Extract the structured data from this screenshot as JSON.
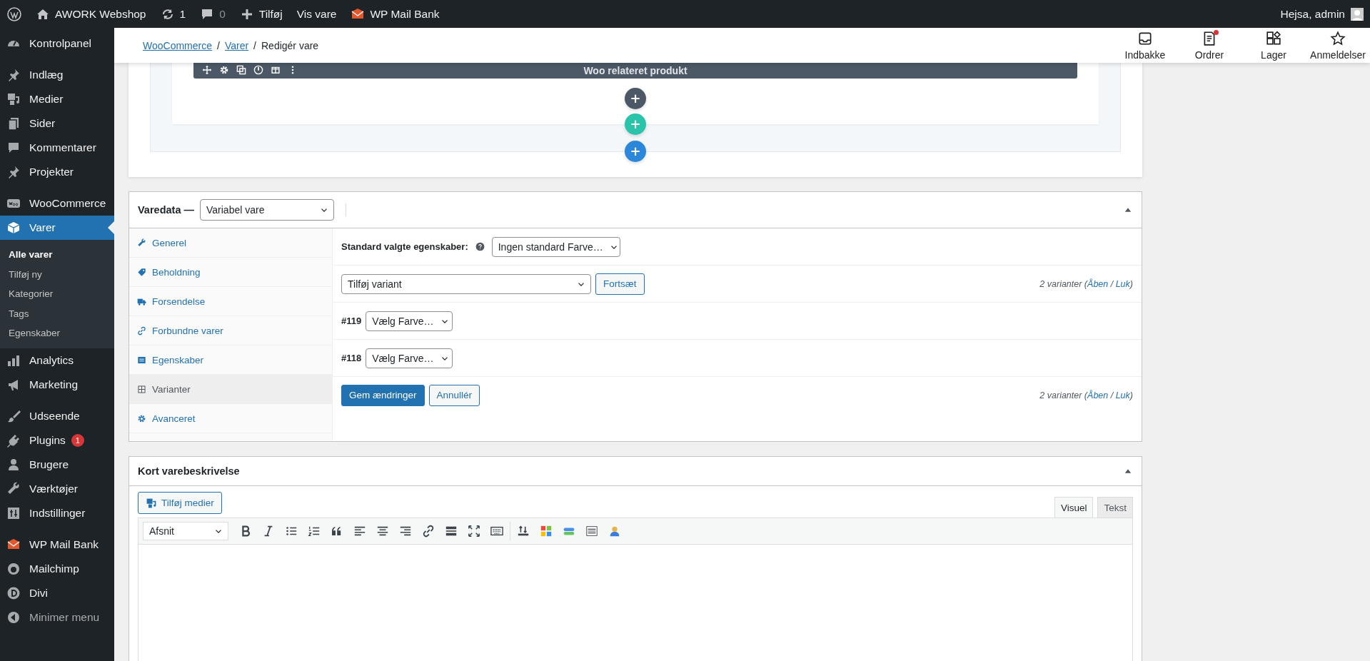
{
  "admin_bar": {
    "site": "AWORK Webshop",
    "updates": "1",
    "comments": "0",
    "new": "Tilføj",
    "view": "Vis vare",
    "plugin": "WP Mail Bank",
    "greeting": "Hejsa, admin"
  },
  "sidebar": {
    "groups": [
      [
        {
          "label": "Kontrolpanel",
          "current": false
        }
      ],
      [
        {
          "label": "Indlæg",
          "current": false
        },
        {
          "label": "Medier",
          "current": false
        },
        {
          "label": "Sider",
          "current": false
        },
        {
          "label": "Kommentarer",
          "current": false
        },
        {
          "label": "Projekter",
          "current": false
        }
      ],
      [
        {
          "label": "WooCommerce",
          "current": false
        },
        {
          "label": "Varer",
          "current": true,
          "children": [
            {
              "label": "Alle varer",
              "selected": true
            },
            {
              "label": "Tilføj ny",
              "selected": false
            },
            {
              "label": "Kategorier",
              "selected": false
            },
            {
              "label": "Tags",
              "selected": false
            },
            {
              "label": "Egenskaber",
              "selected": false
            }
          ]
        },
        {
          "label": "Analytics",
          "current": false
        },
        {
          "label": "Marketing",
          "current": false
        }
      ],
      [
        {
          "label": "Udseende",
          "current": false
        },
        {
          "label": "Plugins",
          "current": false,
          "badge": "1"
        },
        {
          "label": "Brugere",
          "current": false
        },
        {
          "label": "Værktøjer",
          "current": false
        },
        {
          "label": "Indstillinger",
          "current": false
        }
      ],
      [
        {
          "label": "WP Mail Bank",
          "current": false
        },
        {
          "label": "Mailchimp",
          "current": false
        },
        {
          "label": "Divi",
          "current": false
        },
        {
          "label": "Minimer menu",
          "current": false
        }
      ]
    ]
  },
  "header": {
    "breadcrumbs": [
      {
        "kind": "link",
        "text": "WooCommerce"
      },
      {
        "kind": "separator",
        "text": "/"
      },
      {
        "kind": "link",
        "text": "Varer"
      },
      {
        "kind": "separator",
        "text": "/"
      },
      {
        "kind": "current",
        "text": "Redigér vare"
      }
    ],
    "actions": [
      {
        "label": "Indbakke",
        "notification": false
      },
      {
        "label": "Ordrer",
        "notification": true
      },
      {
        "label": "Lager",
        "notification": false
      },
      {
        "label": "Anmeldelser",
        "notification": false
      }
    ]
  },
  "divi": {
    "module_title": "Woo relateret produkt",
    "add_buttons": [
      {
        "label": "+",
        "color": "#4c5866"
      },
      {
        "label": "+",
        "color": "#29c4a9"
      },
      {
        "label": "+",
        "color": "#2b87da"
      }
    ]
  },
  "product_data": {
    "title": "Varedata —",
    "type": "Variabel vare",
    "tabs": [
      {
        "label": "Generel",
        "selected": false
      },
      {
        "label": "Beholdning",
        "selected": false
      },
      {
        "label": "Forsendelse",
        "selected": false
      },
      {
        "label": "Forbundne varer",
        "selected": false
      },
      {
        "label": "Egenskaber",
        "selected": false
      },
      {
        "label": "Varianter",
        "selected": true
      },
      {
        "label": "Avanceret",
        "selected": false
      }
    ],
    "defaults_label": "Standard valgte egenskaber:",
    "defaults_value": "Ingen standard Farve…",
    "add_select": "Tilføj variant",
    "continue": "Fortsæt",
    "summary_top": [
      {
        "kind": "text",
        "text": "2 varianter ("
      },
      {
        "kind": "link",
        "text": "Åben"
      },
      {
        "kind": "text",
        "text": " / "
      },
      {
        "kind": "link",
        "text": "Luk"
      },
      {
        "kind": "text",
        "text": ")"
      }
    ],
    "variations": [
      {
        "id": "#119",
        "value": "Vælg Farve…"
      },
      {
        "id": "#118",
        "value": "Vælg Farve…"
      }
    ],
    "save": "Gem ændringer",
    "cancel": "Annullér",
    "summary_bottom": [
      {
        "kind": "text",
        "text": "2 varianter ("
      },
      {
        "kind": "link",
        "text": "Åben"
      },
      {
        "kind": "text",
        "text": " / "
      },
      {
        "kind": "link",
        "text": "Luk"
      },
      {
        "kind": "text",
        "text": ")"
      }
    ]
  },
  "short_description": {
    "title": "Kort varebeskrivelse",
    "add_media": "Tilføj medier",
    "tabs": [
      {
        "label": "Visuel",
        "selected": true
      },
      {
        "label": "Tekst",
        "selected": false
      }
    ],
    "format": "Afsnit"
  }
}
